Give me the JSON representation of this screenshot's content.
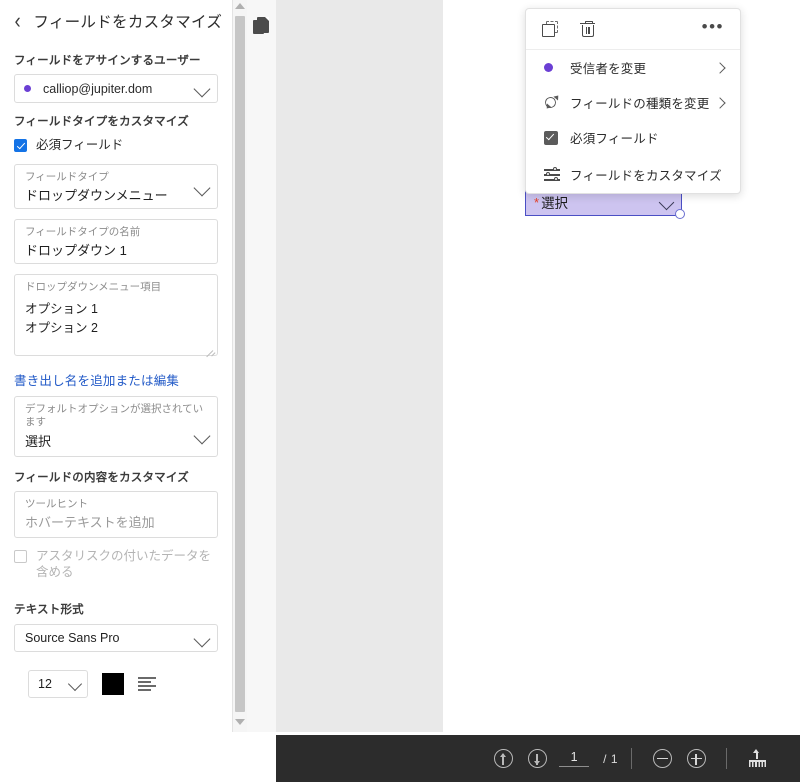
{
  "panel": {
    "title": "フィールドをカスタマイズ",
    "back_icon": "back-chevron-icon",
    "assign_user_label": "フィールドをアサインするユーザー",
    "user_value": "calliop@jupiter.dom",
    "field_type_section_label": "フィールドタイプをカスタマイズ",
    "required_checkbox_label": "必須フィールド",
    "required_checked": true,
    "field_type": {
      "label": "フィールドタイプ",
      "value": "ドロップダウンメニュー"
    },
    "field_name": {
      "label": "フィールドタイプの名前",
      "value": "ドロップダウン 1"
    },
    "options": {
      "label": "ドロップダウンメニュー項目",
      "items": [
        "オプション 1",
        "オプション 2"
      ]
    },
    "export_link": "書き出し名を追加または編集",
    "default_option": {
      "label": "デフォルトオプションが選択されています",
      "value": "選択"
    },
    "content_section_label": "フィールドの内容をカスタマイズ",
    "tooltip": {
      "label": "ツールヒント",
      "placeholder": "ホバーテキストを追加"
    },
    "asterisk_checkbox_label": "アスタリスクの付いたデータを含める",
    "asterisk_checked": false,
    "text_format_label": "テキスト形式",
    "font_family": "Source Sans Pro",
    "font_size": "12",
    "font_color": "#000000",
    "align_icon": "align-left-icon"
  },
  "rail": {
    "pages_icon": "pages-thumbnail-icon"
  },
  "context_menu": {
    "toolbar_icons": [
      {
        "name": "duplicate-icon"
      },
      {
        "name": "trash-icon"
      }
    ],
    "more_label": "•••",
    "items": [
      {
        "icon": "recipient-dot-icon",
        "label": "受信者を変更",
        "has_submenu": true
      },
      {
        "icon": "sync-icon",
        "label": "フィールドの種類を変更",
        "has_submenu": true
      },
      {
        "icon": "checkbox-checked-icon",
        "label": "必須フィールド",
        "has_submenu": false
      },
      {
        "icon": "sliders-icon",
        "label": "フィールドをカスタマイズ",
        "has_submenu": false
      }
    ]
  },
  "document": {
    "field": {
      "required_marker": "*",
      "value": "選択",
      "chevron_icon": "chevron-down-icon",
      "fill_color": "#cdc4f0",
      "border_color": "#4a4fc4"
    }
  },
  "bottom_bar": {
    "prev_page_icon": "arrow-up-circle-icon",
    "next_page_icon": "arrow-down-circle-icon",
    "page_number": "1",
    "page_total": "/ 1",
    "zoom_out_icon": "zoom-out-icon",
    "zoom_in_icon": "zoom-in-icon",
    "upload_icon": "upload-icon"
  }
}
